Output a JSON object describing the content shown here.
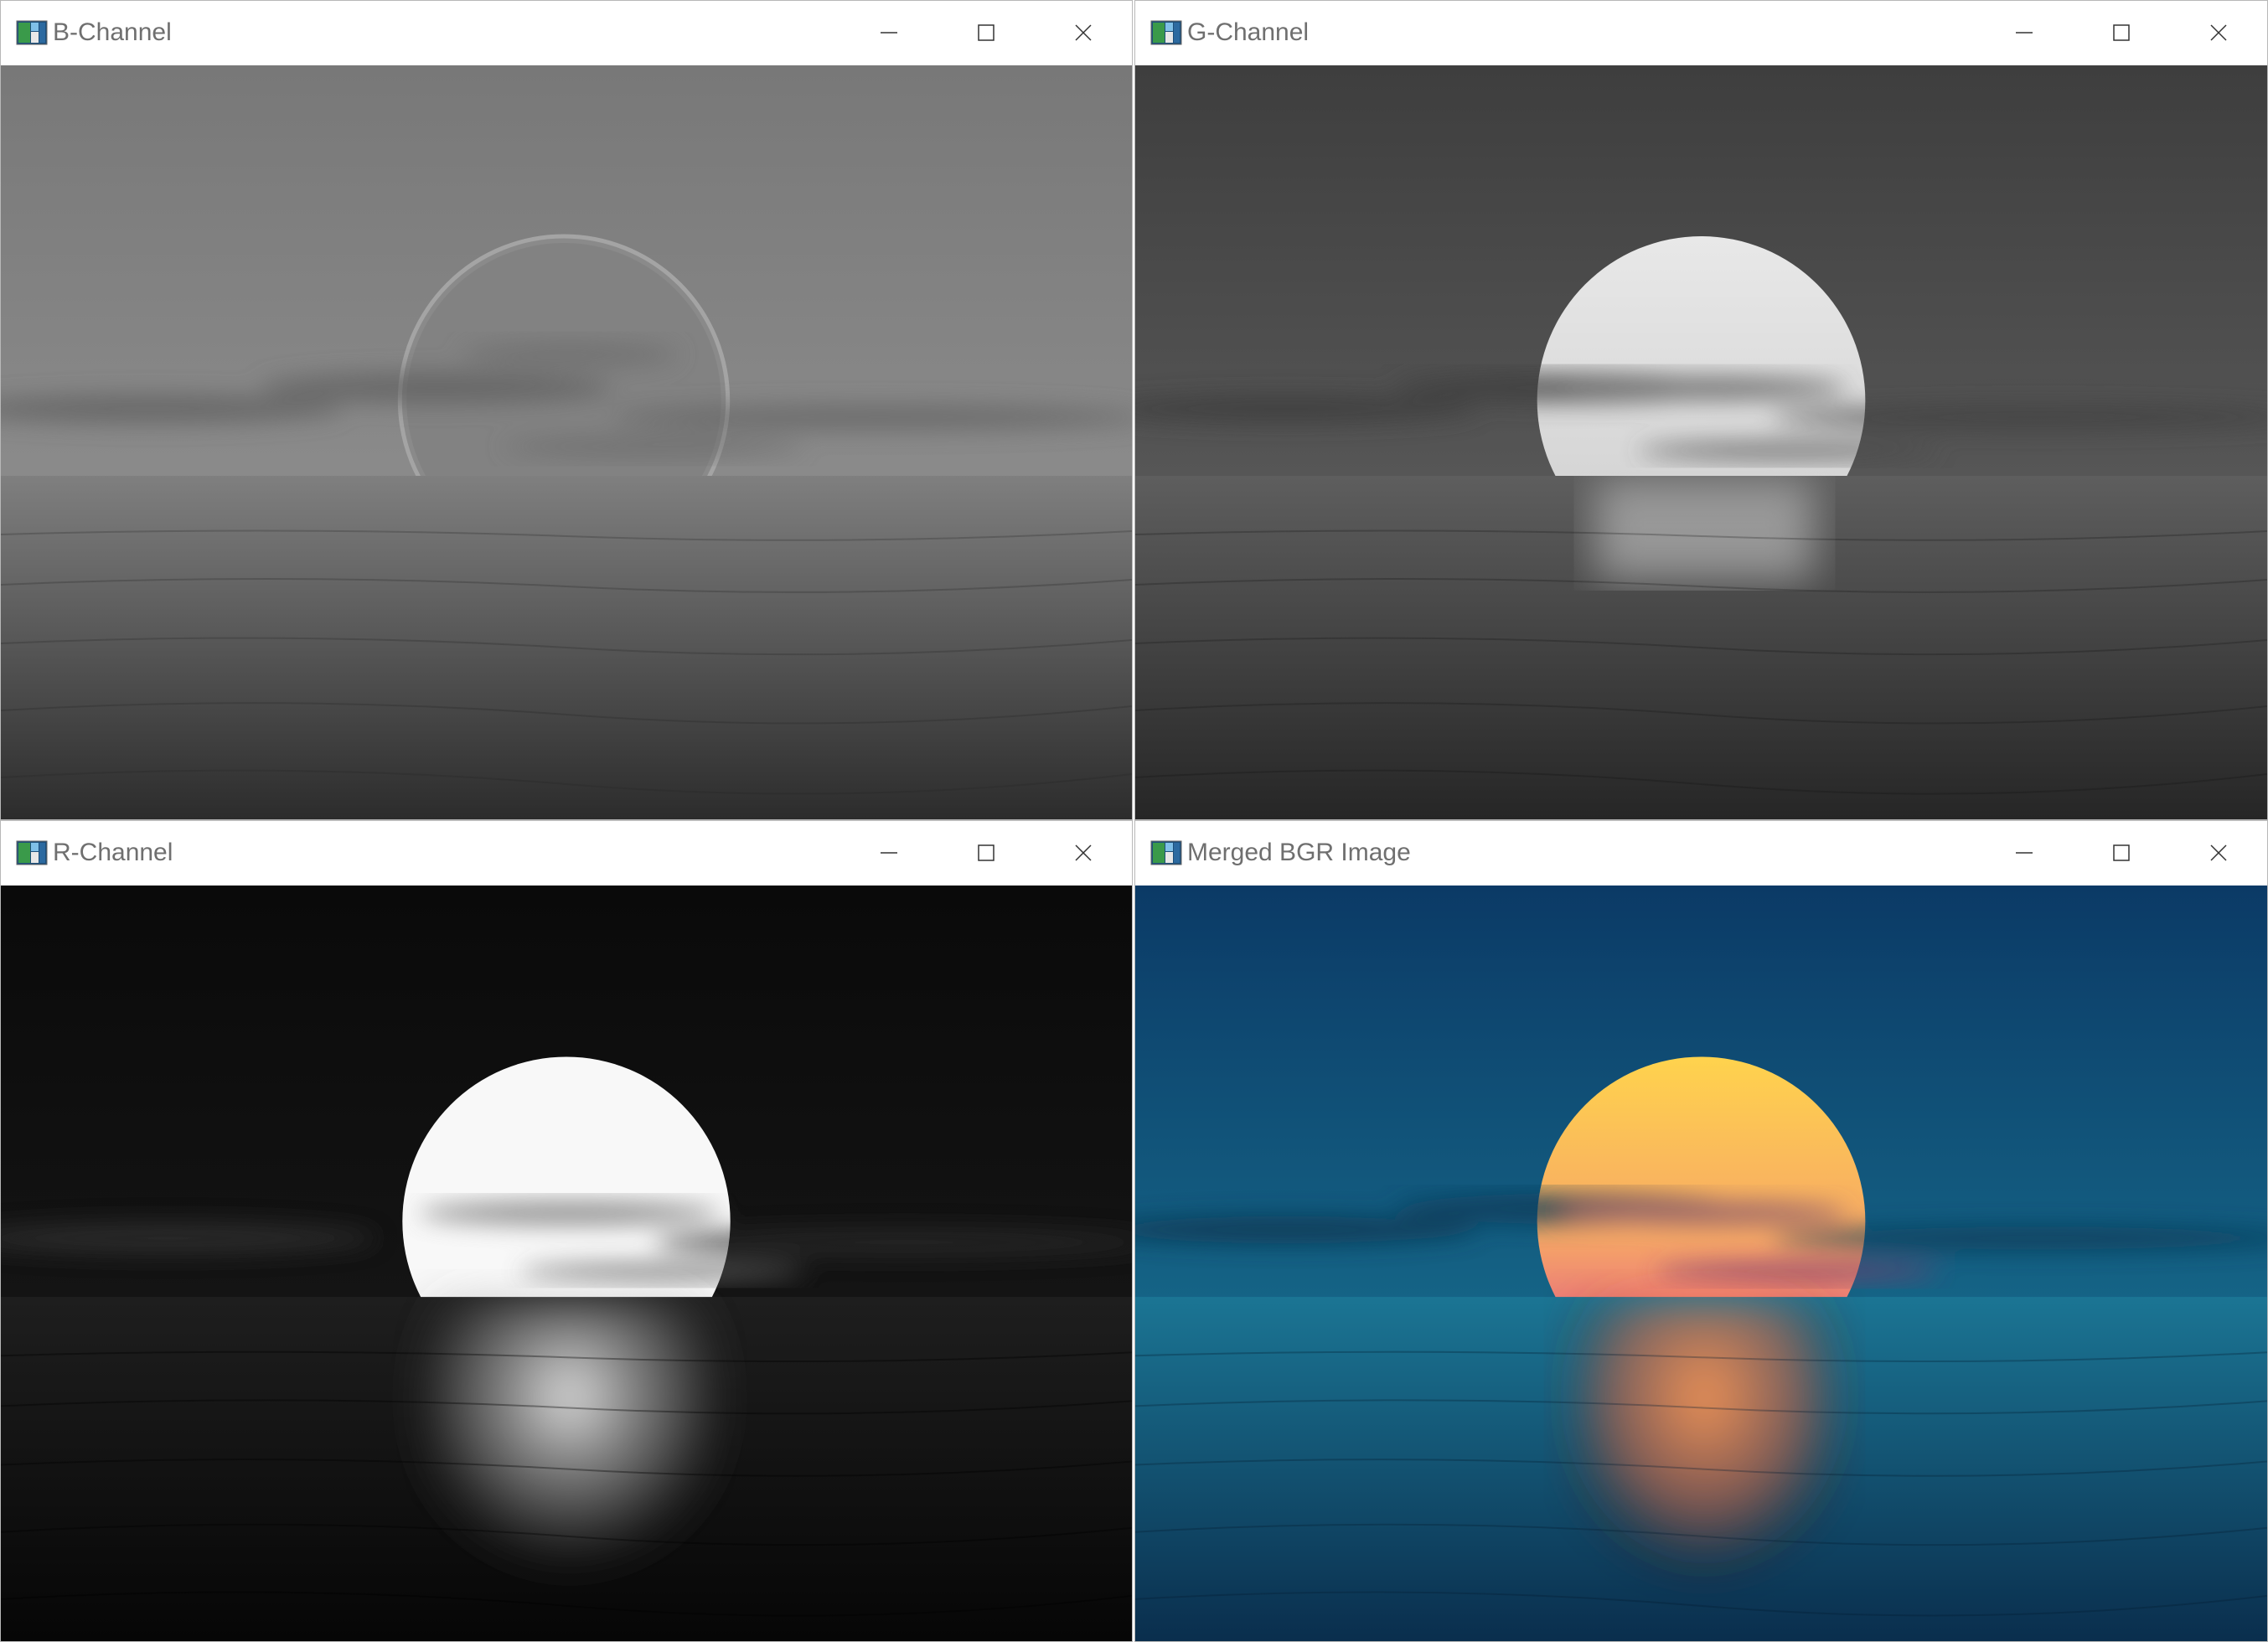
{
  "windows": [
    {
      "id": "b",
      "title": "B-Channel"
    },
    {
      "id": "g",
      "title": "G-Channel"
    },
    {
      "id": "r",
      "title": "R-Channel"
    },
    {
      "id": "m",
      "title": "Merged BGR Image"
    }
  ],
  "icons": {
    "app": "app-image-icon",
    "minimize": "minimize-icon",
    "maximize": "maximize-icon",
    "close": "close-icon"
  },
  "colors": {
    "b_sky_top": "#7a7a7a",
    "b_sea": "#3c3c3c",
    "g_sky_top": "#444444",
    "g_sun": "#e6e6e6",
    "r_sky": "#0b0b0b",
    "r_sun": "#fafafa",
    "m_sky_top": "#0b3a66",
    "m_sky_bottom": "#1a7b95",
    "m_sun_top": "#ffd34d",
    "m_sun_bottom": "#e2508a",
    "m_sea": "#0d3f63"
  }
}
